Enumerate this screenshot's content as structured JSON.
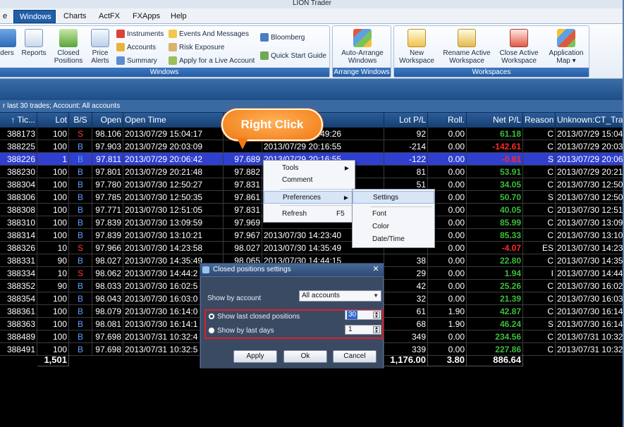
{
  "window": {
    "title": "LION Trader"
  },
  "menu": {
    "items": [
      "e",
      "Windows",
      "Charts",
      "ActFX",
      "FXApps",
      "Help"
    ]
  },
  "ribbon": {
    "windows_group": {
      "label": "Windows",
      "orders": "ders",
      "reports": "Reports",
      "closed_positions": [
        "Closed",
        "Positions"
      ],
      "price_alerts": [
        "Price",
        "Alerts"
      ],
      "instruments": "Instruments",
      "accounts": "Accounts",
      "summary": "Summary",
      "events": "Events And Messages",
      "risk": "Risk Exposure",
      "apply_live": "Apply for a Live Account",
      "bloomberg": "Bloomberg",
      "quick_start": "Quick Start Guide"
    },
    "arrange_group": {
      "label": "Arrange Windows",
      "auto_arrange": [
        "Auto-Arrange",
        "Windows"
      ]
    },
    "workspaces_group": {
      "label": "Workspaces",
      "new_ws": [
        "New",
        "Workspace"
      ],
      "rename_ws": [
        "Rename Active",
        "Workspace"
      ],
      "close_ws": [
        "Close Active",
        "Workspace"
      ],
      "app_map": [
        "Application",
        "Map ▾"
      ]
    }
  },
  "filter": {
    "text": "r last 30 trades; Account: All accounts"
  },
  "grid": {
    "columns": [
      "↑ Tic...",
      "Lot",
      "B/S",
      "Open",
      "Open Time",
      "Close",
      "Close Time",
      "Lot P/L",
      "Roll.",
      "Net P/L",
      "Reason",
      "Unknown:CT_Tra"
    ],
    "rows": [
      [
        "388173",
        "100",
        "S",
        "98.106",
        "2013/07/29 15:04:17",
        "",
        "2013/07/29 19:49:26",
        "92",
        "0.00",
        "61.18",
        "C",
        "2013/07/29 15:04"
      ],
      [
        "388225",
        "100",
        "B",
        "97.903",
        "2013/07/29 20:03:09",
        "",
        "2013/07/29 20:16:55",
        "-214",
        "0.00",
        "-142.61",
        "C",
        "2013/07/29 20:03"
      ],
      [
        "388226",
        "1",
        "B",
        "97.811",
        "2013/07/29 20:06:42",
        "97.689",
        "2013/07/29 20:16:55",
        "-122",
        "0.00",
        "-0.81",
        "S",
        "2013/07/29 20:06"
      ],
      [
        "388230",
        "100",
        "B",
        "97.801",
        "2013/07/29 20:21:48",
        "97.882",
        "",
        "81",
        "0.00",
        "53.91",
        "C",
        "2013/07/29 20:21"
      ],
      [
        "388304",
        "100",
        "B",
        "97.780",
        "2013/07/30 12:50:27",
        "97.831",
        "",
        "51",
        "0.00",
        "34.05",
        "C",
        "2013/07/30 12:50"
      ],
      [
        "388306",
        "100",
        "B",
        "97.785",
        "2013/07/30 12:50:35",
        "97.861",
        "",
        "",
        "0.00",
        "50.70",
        "S",
        "2013/07/30 12:50"
      ],
      [
        "388308",
        "100",
        "B",
        "97.771",
        "2013/07/30 12:51:05",
        "97.831",
        "",
        "",
        "0.00",
        "40.05",
        "C",
        "2013/07/30 12:51"
      ],
      [
        "388310",
        "100",
        "B",
        "97.839",
        "2013/07/30 13:09:59",
        "97.969",
        "",
        "",
        "0.00",
        "85.99",
        "C",
        "2013/07/30 13:09"
      ],
      [
        "388314",
        "100",
        "B",
        "97.839",
        "2013/07/30 13:10:21",
        "97.967",
        "2013/07/30 14:23:40",
        "",
        "0.00",
        "85.33",
        "C",
        "2013/07/30 13:10"
      ],
      [
        "388326",
        "10",
        "S",
        "97.966",
        "2013/07/30 14:23:58",
        "98.027",
        "2013/07/30 14:35:49",
        "",
        "0.00",
        "-4.07",
        "ES",
        "2013/07/30 14:23"
      ],
      [
        "388331",
        "90",
        "B",
        "98.027",
        "2013/07/30 14:35:49",
        "98.065",
        "2013/07/30 14:44:15",
        "38",
        "0.00",
        "22.80",
        "C",
        "2013/07/30 14:35"
      ],
      [
        "388334",
        "10",
        "S",
        "98.062",
        "2013/07/30 14:44:2",
        "",
        "",
        "29",
        "0.00",
        "1.94",
        "I",
        "2013/07/30 14:44"
      ],
      [
        "388352",
        "90",
        "B",
        "98.033",
        "2013/07/30 16:02:5",
        "",
        "",
        "42",
        "0.00",
        "25.26",
        "C",
        "2013/07/30 16:02"
      ],
      [
        "388354",
        "100",
        "B",
        "98.043",
        "2013/07/30 16:03:0",
        "",
        "",
        "32",
        "0.00",
        "21.39",
        "C",
        "2013/07/30 16:03"
      ],
      [
        "388361",
        "100",
        "B",
        "98.079",
        "2013/07/30 16:14:0",
        "",
        "",
        "61",
        "1.90",
        "42.87",
        "C",
        "2013/07/30 16:14"
      ],
      [
        "388363",
        "100",
        "B",
        "98.081",
        "2013/07/30 16:14:1",
        "",
        "",
        "68",
        "1.90",
        "46.24",
        "S",
        "2013/07/30 16:14"
      ],
      [
        "388489",
        "100",
        "B",
        "97.698",
        "2013/07/31 10:32:4",
        "",
        "",
        "349",
        "0.00",
        "234.56",
        "C",
        "2013/07/31 10:32"
      ],
      [
        "388491",
        "100",
        "B",
        "97.698",
        "2013/07/31 10:32:5",
        "",
        "",
        "339",
        "0.00",
        "227.86",
        "C",
        "2013/07/31 10:32"
      ]
    ],
    "totals": {
      "lot": "1,501",
      "lot_pl": "1,176.00",
      "roll": "3.80",
      "net_pl": "886.64"
    }
  },
  "callout": {
    "text": "Right Click"
  },
  "context_menu": {
    "tools": "Tools",
    "comment": "Comment",
    "preferences": "Preferences",
    "refresh": "Refresh",
    "refresh_shortcut": "F5"
  },
  "submenu": {
    "settings": "Settings",
    "font": "Font",
    "color": "Color",
    "datetime": "Date/Time"
  },
  "dialog": {
    "title": "Closed positions settings",
    "show_by_account_label": "Show by account",
    "account_value": "All accounts",
    "opt_last_closed": "Show last closed positions",
    "opt_last_days": "Show by last days",
    "last_closed_value": "30",
    "last_days_value": "1",
    "apply": "Apply",
    "ok": "Ok",
    "cancel": "Cancel"
  },
  "colors": {
    "positive": "#3cbe3c",
    "negative": "#ff2a2a",
    "selected_row": "#2f3fcf",
    "callout": "#f07a12",
    "highlight_box": "#d9202a"
  }
}
